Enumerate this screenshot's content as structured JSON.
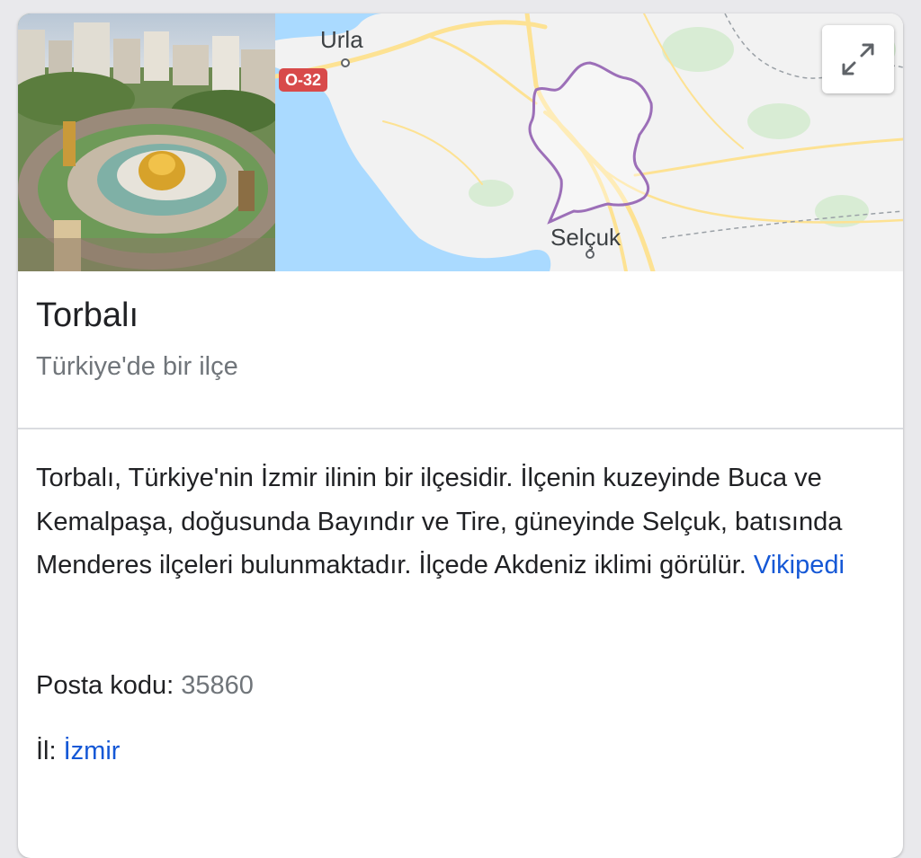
{
  "map": {
    "labels": {
      "urla": "Urla",
      "route": "O-32",
      "selcuk": "Selçuk"
    },
    "expand_icon": "expand-icon",
    "colors": {
      "water": "#aadaff",
      "land": "#f2f2f2",
      "road": "#fde293",
      "boundary": "#9c6fb8",
      "route_badge": "#d84a4a"
    }
  },
  "place": {
    "name": "Torbalı",
    "type": "Türkiye'de bir ilçe"
  },
  "description": {
    "text": "Torbalı, Türkiye'nin İzmir ilinin bir ilçesidir. İlçenin kuzeyinde Buca ve Kemalpaşa, doğusunda Bayındır ve Tire, güneyinde Selçuk, batısında Menderes ilçeleri bulunmaktadır. İlçede Akdeniz iklimi görülür.",
    "source_link": "Vikipedi"
  },
  "facts": {
    "postal": {
      "label": "Posta kodu:",
      "value": "35860"
    },
    "province": {
      "label": "İl:",
      "value": "İzmir"
    }
  }
}
